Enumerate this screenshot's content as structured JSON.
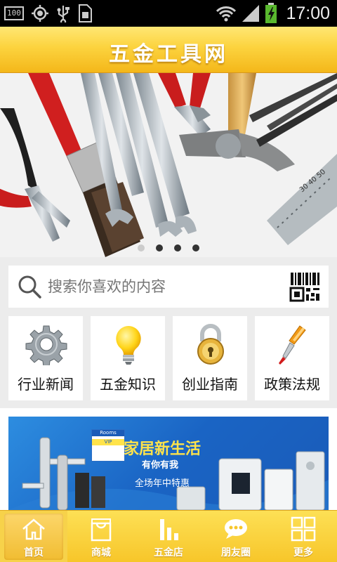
{
  "status_bar": {
    "battery_box": "100",
    "time": "17:00",
    "icons": [
      "battery-100-indicator-icon",
      "gps-icon",
      "usb-icon",
      "sim-card-icon",
      "wifi-icon",
      "signal-icon",
      "battery-charging-icon"
    ]
  },
  "header": {
    "title": "五金工具网"
  },
  "banner": {
    "image": "hardware-tools-photo",
    "slides": 4,
    "active_slide": 0
  },
  "search": {
    "placeholder": "搜索你喜欢的内容",
    "icon": "search-icon",
    "scan_icon": "qr-scan-icon"
  },
  "categories": [
    {
      "label": "行业新闻",
      "icon": "gear-icon"
    },
    {
      "label": "五金知识",
      "icon": "lightbulb-icon"
    },
    {
      "label": "创业指南",
      "icon": "padlock-icon"
    },
    {
      "label": "政策法规",
      "icon": "screwdriver-icon"
    }
  ],
  "promo": {
    "title": "家居新生活",
    "subtitle": "有你有我",
    "sale": "全场年中特惠"
  },
  "bottom_nav": [
    {
      "label": "首页",
      "icon": "home-icon",
      "active": true
    },
    {
      "label": "商城",
      "icon": "shopping-bag-icon",
      "active": false
    },
    {
      "label": "五金店",
      "icon": "bar-chart-icon",
      "active": false
    },
    {
      "label": "朋友圈",
      "icon": "chat-bubble-icon",
      "active": false
    },
    {
      "label": "更多",
      "icon": "grid-more-icon",
      "active": false
    }
  ],
  "colors": {
    "accent": "#f7c62a",
    "header_top": "#ffe774",
    "header_bottom": "#f4b71a",
    "promo_blue": "#1a64c4",
    "promo_yellow": "#ffe34a"
  }
}
